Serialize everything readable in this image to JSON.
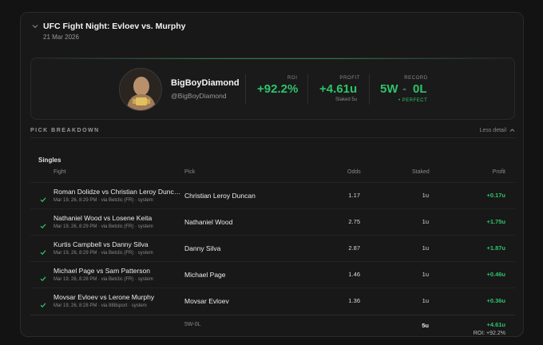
{
  "event": {
    "title": "UFC Fight Night: Evloev vs. Murphy",
    "date": "21 Mar 2026"
  },
  "user": {
    "name": "BigBoyDiamond",
    "handle": "@BigBoyDiamond"
  },
  "stats": {
    "roi_label": "ROI",
    "roi_value": "+92.2%",
    "profit_label": "PROFIT",
    "profit_value": "+4.61u",
    "profit_sub": "Staked 5u",
    "record_label": "RECORD",
    "record_w": "5W",
    "record_sep": "-",
    "record_l": "0L",
    "record_sub": "• PERFECT"
  },
  "breakdown": {
    "title": "PICK BREAKDOWN",
    "toggle": "Less detail",
    "section": "Singles",
    "columns": {
      "fight": "Fight",
      "pick": "Pick",
      "odds": "Odds",
      "staked": "Staked",
      "profit": "Profit"
    },
    "rows": [
      {
        "fight": "Roman Dolidze vs Christian Leroy Duncan",
        "meta": "Mar 19, 26, 8:29 PM · via Betclic (FR) · system",
        "pick": "Christian Leroy Duncan",
        "odds": "1.17",
        "staked": "1u",
        "profit": "+0.17u"
      },
      {
        "fight": "Nathaniel Wood vs Losene Keita",
        "meta": "Mar 19, 26, 8:29 PM · via Betclic (FR) · system",
        "pick": "Nathaniel Wood",
        "odds": "2.75",
        "staked": "1u",
        "profit": "+1.75u"
      },
      {
        "fight": "Kurtis Campbell vs Danny Silva",
        "meta": "Mar 19, 26, 8:29 PM · via Betclic (FR) · system",
        "pick": "Danny Silva",
        "odds": "2.87",
        "staked": "1u",
        "profit": "+1.87u"
      },
      {
        "fight": "Michael Page vs Sam Patterson",
        "meta": "Mar 19, 26, 8:28 PM · via Betclic (FR) · system",
        "pick": "Michael Page",
        "odds": "1.46",
        "staked": "1u",
        "profit": "+0.46u"
      },
      {
        "fight": "Movsar Evloev vs Lerone Murphy",
        "meta": "Mar 19, 26, 8:28 PM · via 888sport · system",
        "pick": "Movsar Evloev",
        "odds": "1.36",
        "staked": "1u",
        "profit": "+0.36u"
      }
    ],
    "footer": {
      "record": "5W-0L",
      "staked": "5u",
      "profit": "+4.61u",
      "roi": "ROI: +92.2%"
    }
  },
  "colors": {
    "accent": "#2fc26b",
    "background": "#131313",
    "card": "#181818"
  }
}
